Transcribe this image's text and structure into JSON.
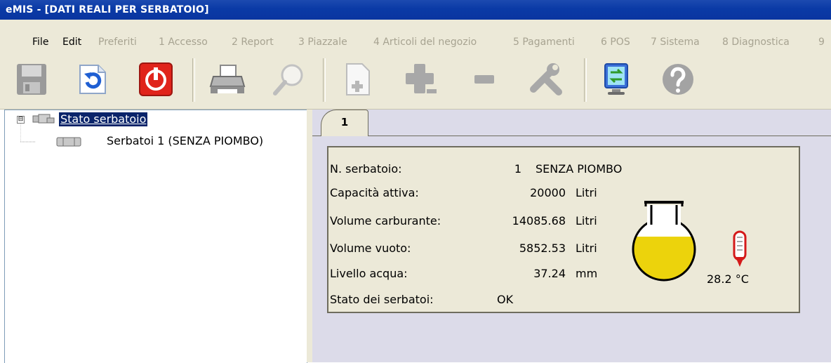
{
  "window": {
    "title": "eMIS - [DATI REALI PER SERBATOIO]"
  },
  "menu": {
    "items": [
      {
        "label": "File",
        "enabled": true
      },
      {
        "label": "Edit",
        "enabled": true
      },
      {
        "label": "Preferiti",
        "enabled": false
      },
      {
        "label": "1 Accesso",
        "enabled": false
      },
      {
        "label": "2 Report",
        "enabled": false
      },
      {
        "label": "3 Piazzale",
        "enabled": false
      },
      {
        "label": "4 Articoli del negozio",
        "enabled": false
      },
      {
        "label": "5 Pagamenti",
        "enabled": false
      },
      {
        "label": "6 POS",
        "enabled": false
      },
      {
        "label": "7 Sistema",
        "enabled": false
      },
      {
        "label": "8 Diagnostica",
        "enabled": false
      },
      {
        "label": "9",
        "enabled": false
      }
    ]
  },
  "toolbar": {
    "buttons": [
      {
        "icon": "save-icon",
        "enabled": false
      },
      {
        "icon": "undo-icon",
        "enabled": true
      },
      {
        "icon": "power-icon",
        "enabled": true
      },
      {
        "icon": "printer-icon",
        "enabled": true
      },
      {
        "icon": "magnifier-icon",
        "enabled": false
      },
      {
        "icon": "new-document-icon",
        "enabled": false
      },
      {
        "icon": "add-icon",
        "enabled": false
      },
      {
        "icon": "remove-icon",
        "enabled": false
      },
      {
        "icon": "tools-icon",
        "enabled": false
      },
      {
        "icon": "network-monitor-icon",
        "enabled": true
      },
      {
        "icon": "help-icon",
        "enabled": false
      }
    ]
  },
  "tree": {
    "expander": "⊟",
    "root": {
      "label": "Stato serbatoio"
    },
    "children": [
      {
        "label": "Serbatoi 1 (SENZA PIOMBO)"
      }
    ]
  },
  "tab": {
    "label": "1"
  },
  "details": {
    "tank_number": {
      "label": "N. serbatoio:",
      "value": "1",
      "extra": "SENZA PIOMBO"
    },
    "active_capacity": {
      "label": "Capacità attiva:",
      "value": "20000",
      "unit": "Litri"
    },
    "fuel_volume": {
      "label": "Volume carburante:",
      "value": "14085.68",
      "unit": "Litri"
    },
    "empty_volume": {
      "label": "Volume vuoto:",
      "value": "5852.53",
      "unit": "Litri"
    },
    "water_level": {
      "label": "Livello acqua:",
      "value": "37.24",
      "unit": "mm"
    },
    "tank_status": {
      "label": "Stato dei serbatoi:",
      "value": "OK"
    },
    "fill_fraction": 0.704,
    "temperature": "28.2 °C"
  },
  "colors": {
    "fuel": "#ecd30c",
    "titlebar": "#0a3aa6",
    "thermometer": "#d41a1a"
  }
}
